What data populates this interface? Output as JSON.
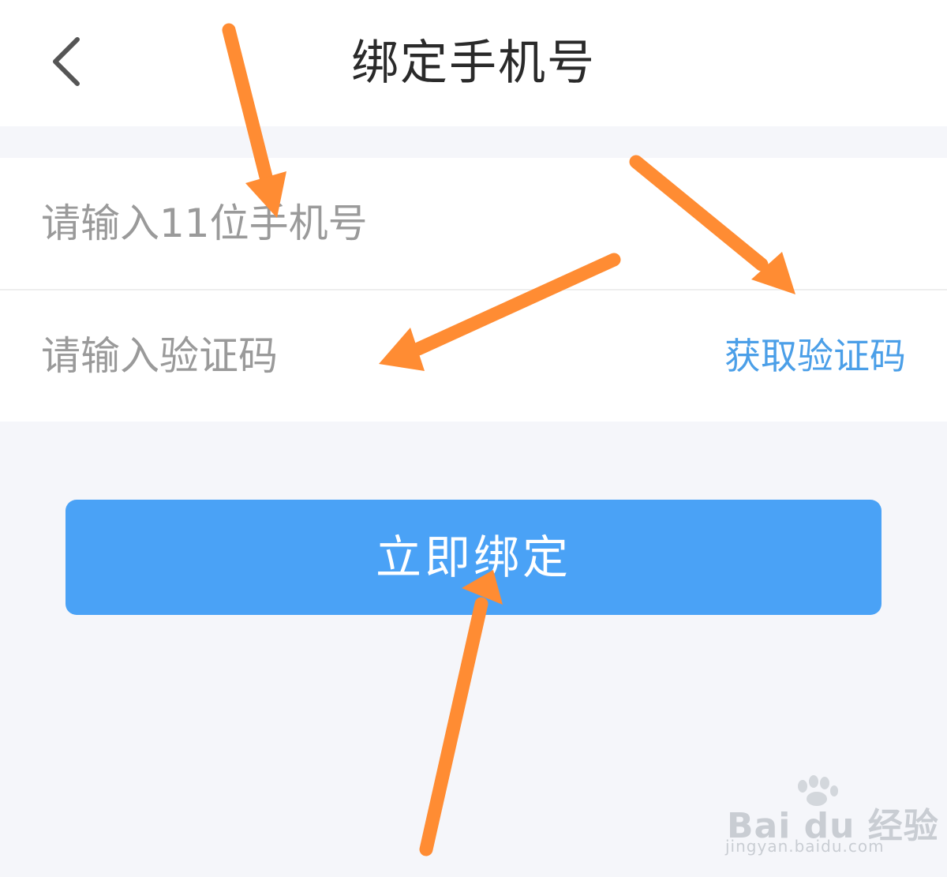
{
  "header": {
    "title": "绑定手机号",
    "back_icon": "chevron-left-icon"
  },
  "form": {
    "phone_placeholder": "请输入11位手机号",
    "code_placeholder": "请输入验证码",
    "get_code_label": "获取验证码"
  },
  "bind_button": {
    "label": "立即绑定"
  },
  "watermark": {
    "logo_text": "Bai du 经验",
    "url_text": "jingyan.baidu.com"
  },
  "colors": {
    "page_background": "#f5f6fa",
    "accent_blue": "#4aa2f6",
    "link_blue": "#4b9fe8",
    "annotation_orange": "#ff8c33"
  }
}
